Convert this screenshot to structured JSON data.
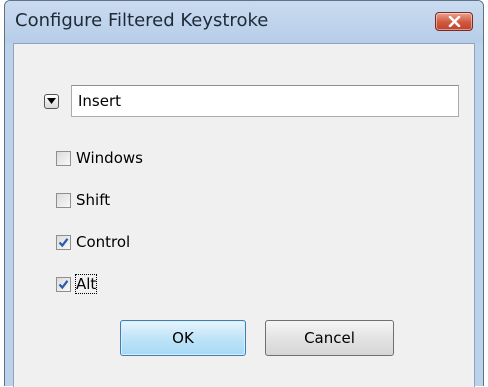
{
  "dialog": {
    "title": "Configure Filtered Keystroke",
    "close_icon": "close-x-icon"
  },
  "key": {
    "dropdown_icon": "dropdown-arrow-icon",
    "value": "Insert"
  },
  "modifiers": [
    {
      "label": "Windows",
      "checked": false
    },
    {
      "label": "Shift",
      "checked": false
    },
    {
      "label": "Control",
      "checked": true
    },
    {
      "label": "Alt",
      "checked": true,
      "focused": true
    }
  ],
  "buttons": {
    "ok_label": "OK",
    "cancel_label": "Cancel"
  },
  "colors": {
    "title_bar": "#bcd1ea",
    "close_button": "#c9503a",
    "dialog_background": "#f0f0f0",
    "default_button": "#bfe4f8",
    "check_mark": "#2a5ba8"
  }
}
